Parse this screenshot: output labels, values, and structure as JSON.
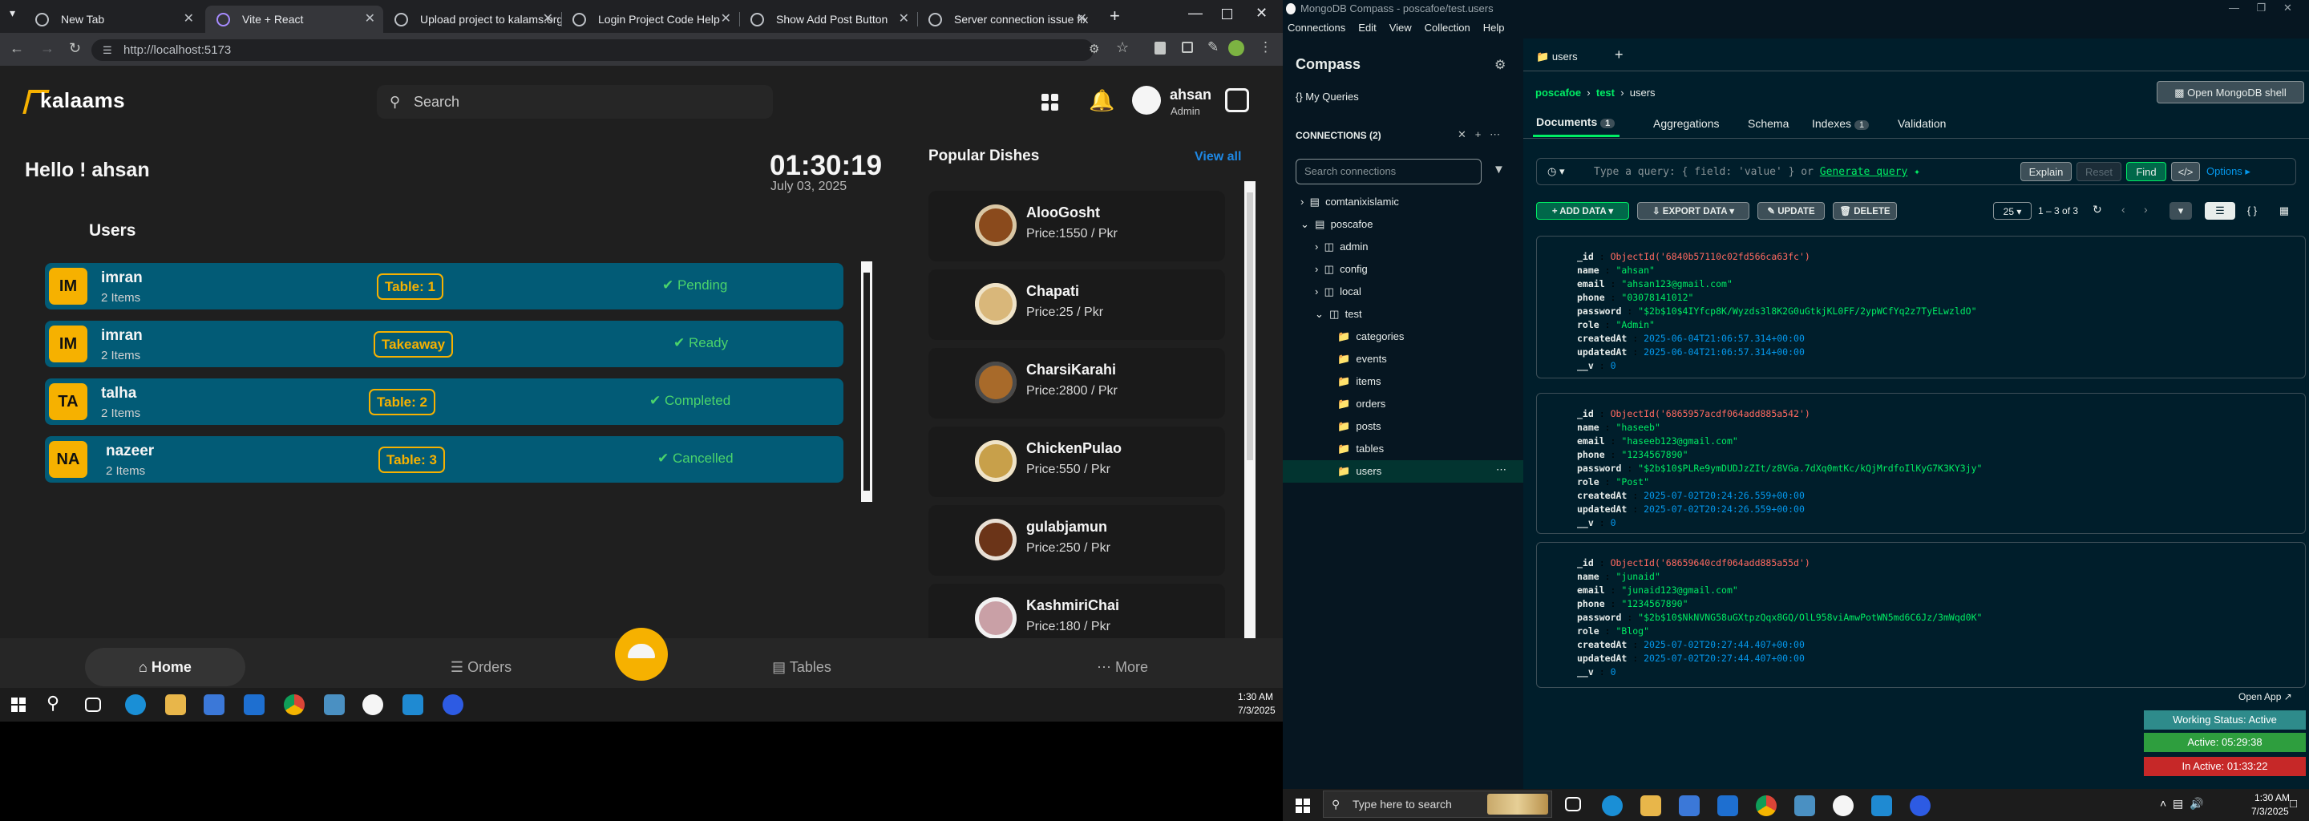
{
  "browser": {
    "tabs": [
      {
        "label": "New Tab",
        "active": false
      },
      {
        "label": "Vite + React",
        "active": true
      },
      {
        "label": "Upload project to kalams.org",
        "active": false
      },
      {
        "label": "Login Project Code Help",
        "active": false
      },
      {
        "label": "Show Add Post Button",
        "active": false
      },
      {
        "label": "Server connection issue fix",
        "active": false
      }
    ],
    "url": "http://localhost:5173"
  },
  "app": {
    "logo": "kalaams",
    "search_placeholder": "Search",
    "user_name": "ahsan",
    "user_role": "Admin",
    "greeting": "Hello ! ahsan",
    "time": "01:30:19",
    "date": "July 03, 2025",
    "users_title": "Users",
    "users": [
      {
        "initials": "IM",
        "name": "imran",
        "items": "2 Items",
        "table": "Table: 1",
        "status": "Pending",
        "status_color": "#4ad36b"
      },
      {
        "initials": "IM",
        "name": "imran",
        "items": "2 Items",
        "table": "Takeaway",
        "status": "Ready",
        "status_color": "#4ad36b"
      },
      {
        "initials": "TA",
        "name": "talha",
        "items": "2 Items",
        "table": "Table: 2",
        "status": "Completed",
        "status_color": "#4ad36b"
      },
      {
        "initials": "NA",
        "name": "nazeer",
        "items": "2 Items",
        "table": "Table: 3",
        "status": "Cancelled",
        "status_color": "#4ad36b"
      }
    ],
    "popular_title": "Popular Dishes",
    "view_all": "View all",
    "dishes": [
      {
        "name": "AlooGosht",
        "price": "Price:1550 / Pkr",
        "color": "#8a4a1c"
      },
      {
        "name": "Chapati",
        "price": "Price:25 / Pkr",
        "color": "#d9b77a"
      },
      {
        "name": "CharsiKarahi",
        "price": "Price:2800 / Pkr",
        "color": "#a86a2a"
      },
      {
        "name": "ChickenPulao",
        "price": "Price:550 / Pkr",
        "color": "#c8a04a"
      },
      {
        "name": "gulabjamun",
        "price": "Price:250 / Pkr",
        "color": "#6b3418"
      },
      {
        "name": "KashmiriChai",
        "price": "Price:180 / Pkr",
        "color": "#c9a0a6"
      }
    ],
    "nav": {
      "home": "Home",
      "orders": "Orders",
      "tables": "Tables",
      "more": "More"
    }
  },
  "left_taskbar": {
    "time": "1:30 AM",
    "date": "7/3/2025"
  },
  "compass": {
    "window_title": "MongoDB Compass - poscafoe/test.users",
    "menu": [
      "Connections",
      "Edit",
      "View",
      "Collection",
      "Help"
    ],
    "title": "Compass",
    "my_queries": "My Queries",
    "connections_label": "CONNECTIONS (2)",
    "search_placeholder": "Search connections",
    "tree": {
      "conn1": "comtanixislamic",
      "conn2": "poscafoe",
      "dbs": [
        "admin",
        "config",
        "local",
        "test"
      ],
      "collections": [
        "categories",
        "events",
        "items",
        "orders",
        "posts",
        "tables",
        "users"
      ]
    },
    "tab": "users",
    "breadcrumb": [
      "poscafoe",
      "test",
      "users"
    ],
    "open_shell": "Open MongoDB shell",
    "subtabs": [
      {
        "label": "Documents",
        "badge": "1"
      },
      {
        "label": "Aggregations",
        "badge": ""
      },
      {
        "label": "Schema",
        "badge": ""
      },
      {
        "label": "Indexes",
        "badge": "1"
      },
      {
        "label": "Validation",
        "badge": ""
      }
    ],
    "query_placeholder": "Type a query: { field: 'value' } or",
    "generate_query": "Generate query",
    "explain": "Explain",
    "reset": "Reset",
    "find": "Find",
    "options": "Options",
    "add_data": "ADD DATA",
    "export_data": "EXPORT DATA",
    "update": "UPDATE",
    "delete": "DELETE",
    "page_size": "25",
    "range": "1 – 3 of 3",
    "documents": [
      {
        "_id": "ObjectId('6840b57110c02fd566ca63fc')",
        "name": "\"ahsan\"",
        "email": "\"ahsan123@gmail.com\"",
        "phone": "\"03078141012\"",
        "password": "\"$2b$10$4IYfcp8K/Wyzds3l8K2G0uGtkjKL0FF/2ypWCfYq2z7TyELwzldO\"",
        "role": "\"Admin\"",
        "createdAt": "2025-06-04T21:06:57.314+00:00",
        "updatedAt": "2025-06-04T21:06:57.314+00:00",
        "__v": "0"
      },
      {
        "_id": "ObjectId('6865957acdf064add885a542')",
        "name": "\"haseeb\"",
        "email": "\"haseeb123@gmail.com\"",
        "phone": "\"1234567890\"",
        "password": "\"$2b$10$PLRe9ymDUDJzZIt/z8VGa.7dXq0mtKc/kQjMrdfoIlKyG7K3KY3jy\"",
        "role": "\"Post\"",
        "createdAt": "2025-07-02T20:24:26.559+00:00",
        "updatedAt": "2025-07-02T20:24:26.559+00:00",
        "__v": "0"
      },
      {
        "_id": "ObjectId('68659640cdf064add885a55d')",
        "name": "\"junaid\"",
        "email": "\"junaid123@gmail.com\"",
        "phone": "\"1234567890\"",
        "password": "\"$2b$10$NkNVNG58uGXtpzQqx8GQ/OlL958viAmwPotWN5md6C6Jz/3mWqd0K\"",
        "role": "\"Blog\"",
        "createdAt": "2025-07-02T20:27:44.407+00:00",
        "updatedAt": "2025-07-02T20:27:44.407+00:00",
        "__v": "0"
      }
    ],
    "open_app": "Open App",
    "working_status": "Working Status: Active",
    "active_time": "Active: 05:29:38",
    "inactive_time": "In Active: 01:33:22"
  },
  "right_taskbar": {
    "search_placeholder": "Type here to search",
    "time": "1:30 AM",
    "date": "7/3/2025"
  },
  "colors": {
    "accent_yellow": "#f6b100",
    "card_teal": "#025b76",
    "mongo_green": "#00ed64",
    "mongo_bg": "#001e2b"
  }
}
